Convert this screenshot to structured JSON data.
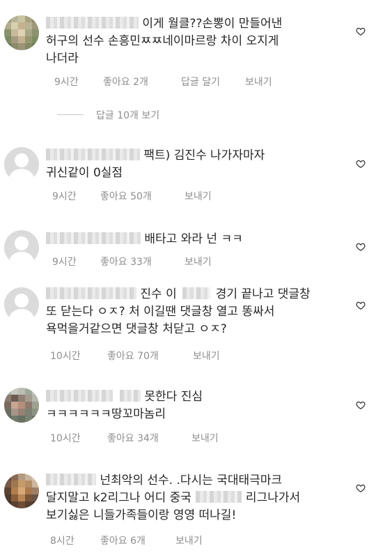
{
  "comments": [
    {
      "lines": [
        "이게 월클??손뽕이 만들어낸",
        "허구의 선수 손흥민ㅉㅉ네이마르랑 차이 오지게",
        "나더라"
      ],
      "time": "9시간",
      "likes": "좋아요 2개",
      "reply": "답글 달기",
      "send": "보내기"
    },
    {
      "lines": [
        "팩트) 김진수 나가자마자",
        "귀신같이 0실점"
      ],
      "time": "9시간",
      "likes": "좋아요 50개",
      "reply": "",
      "send": "보내기"
    },
    {
      "lines": [
        "배타고 와라 넌 ㅋㅋ"
      ],
      "time": "9시간",
      "likes": "좋아요 33개",
      "reply": "",
      "send": "보내기"
    },
    {
      "lines": [
        "진수 이",
        "경기 끝나고 댓글창",
        "또 닫는다 ㅇㅈ? 처 이길땐 댓글창 열고 똥싸서",
        "욕먹을거같으면 댓글창 처닫고 ㅇㅈ?"
      ],
      "time": "10시간",
      "likes": "좋아요 70개",
      "reply": "",
      "send": "보내기"
    },
    {
      "lines": [
        "못한다 진심",
        "ㅋㅋㅋㅋㅋㅋ땅꼬마놈리"
      ],
      "time": "10시간",
      "likes": "좋아요 34개",
      "reply": "",
      "send": "보내기"
    },
    {
      "lines": [
        "넌최악의 선수. .다시는 국대태극마크",
        "달지말고 k2리그나 어디 중국",
        "리그나가서",
        "보기싫은 니들가족들이랑 영영 떠나길!"
      ],
      "time": "8시간",
      "likes": "좋아요 6개",
      "reply": "",
      "send": "보내기"
    }
  ],
  "view_replies": "답글 10개 보기",
  "icons": {
    "like": "heart-outline-icon",
    "avatar_default": "default-avatar-icon"
  },
  "colors": {
    "text": "#262626",
    "meta": "#8e8e8e",
    "avatar_bg": "#dbdbdb"
  }
}
